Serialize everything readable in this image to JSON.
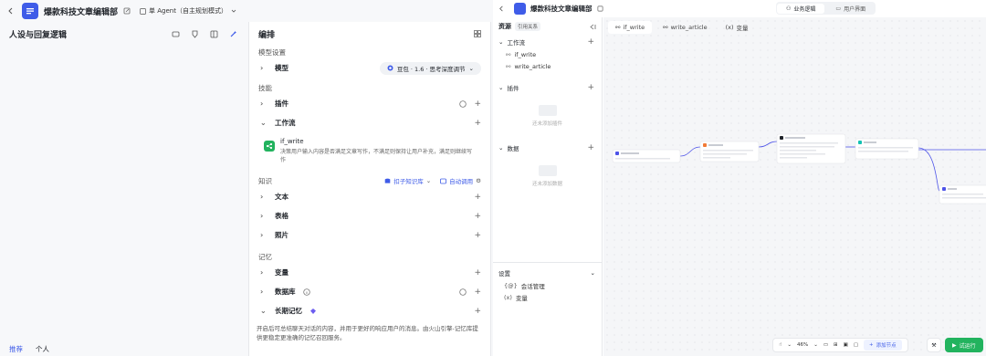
{
  "app": {
    "title": "爆款科技文章编辑部",
    "agent_mode": "单 Agent（自主规划模式）",
    "back_icon": "chevron-left-icon"
  },
  "persona": {
    "title": "人设与回复逻辑",
    "tabs": [
      "推荐",
      "个人"
    ]
  },
  "arrange": {
    "title": "编排",
    "model_section": "模型设置",
    "model_label": "模型",
    "model_value": "豆包 · 1.6 · 思考深度调节",
    "skills_section": "技能",
    "plugins_label": "插件",
    "workflow_label": "工作流",
    "workflow": {
      "name": "if_write",
      "desc": "决策用户输入内容是否满足文章写作，不满足则保持让用户补充，满足则继续写作"
    },
    "knowledge_section": "知识",
    "knowledge_tag": "扣子知识库",
    "auto_call": "自动调用",
    "knowledge_items": [
      "文本",
      "表格",
      "照片"
    ],
    "memory_section": "记忆",
    "memory_items": [
      "变量",
      "数据库",
      "长期记忆"
    ],
    "ltm_desc": "开启后可总结聊天对话的内容，并用于更好的响应用户的消息。由火山引擎-记忆库提供更稳定更准确的记忆召回服务。"
  },
  "right": {
    "title": "爆款科技文章编辑部",
    "view_tabs": [
      "业务逻辑",
      "用户界面"
    ],
    "resources": {
      "title": "资源",
      "ref_tag": "引用关系",
      "workflow_section": "工作流",
      "workflows": [
        "if_write",
        "write_article"
      ],
      "plugins_section": "插件",
      "plugins_empty": "还未添加插件",
      "data_section": "数据",
      "data_empty": "还未添加数据",
      "settings_section": "设置",
      "settings_items": [
        "会话管理",
        "变量"
      ],
      "settings_icons": [
        "{@}",
        "(x)"
      ]
    },
    "canvas_tabs": [
      "if_write",
      "write_article",
      "变量"
    ],
    "zoom": "46%",
    "add_node": "添加节点",
    "run": "试运行"
  }
}
